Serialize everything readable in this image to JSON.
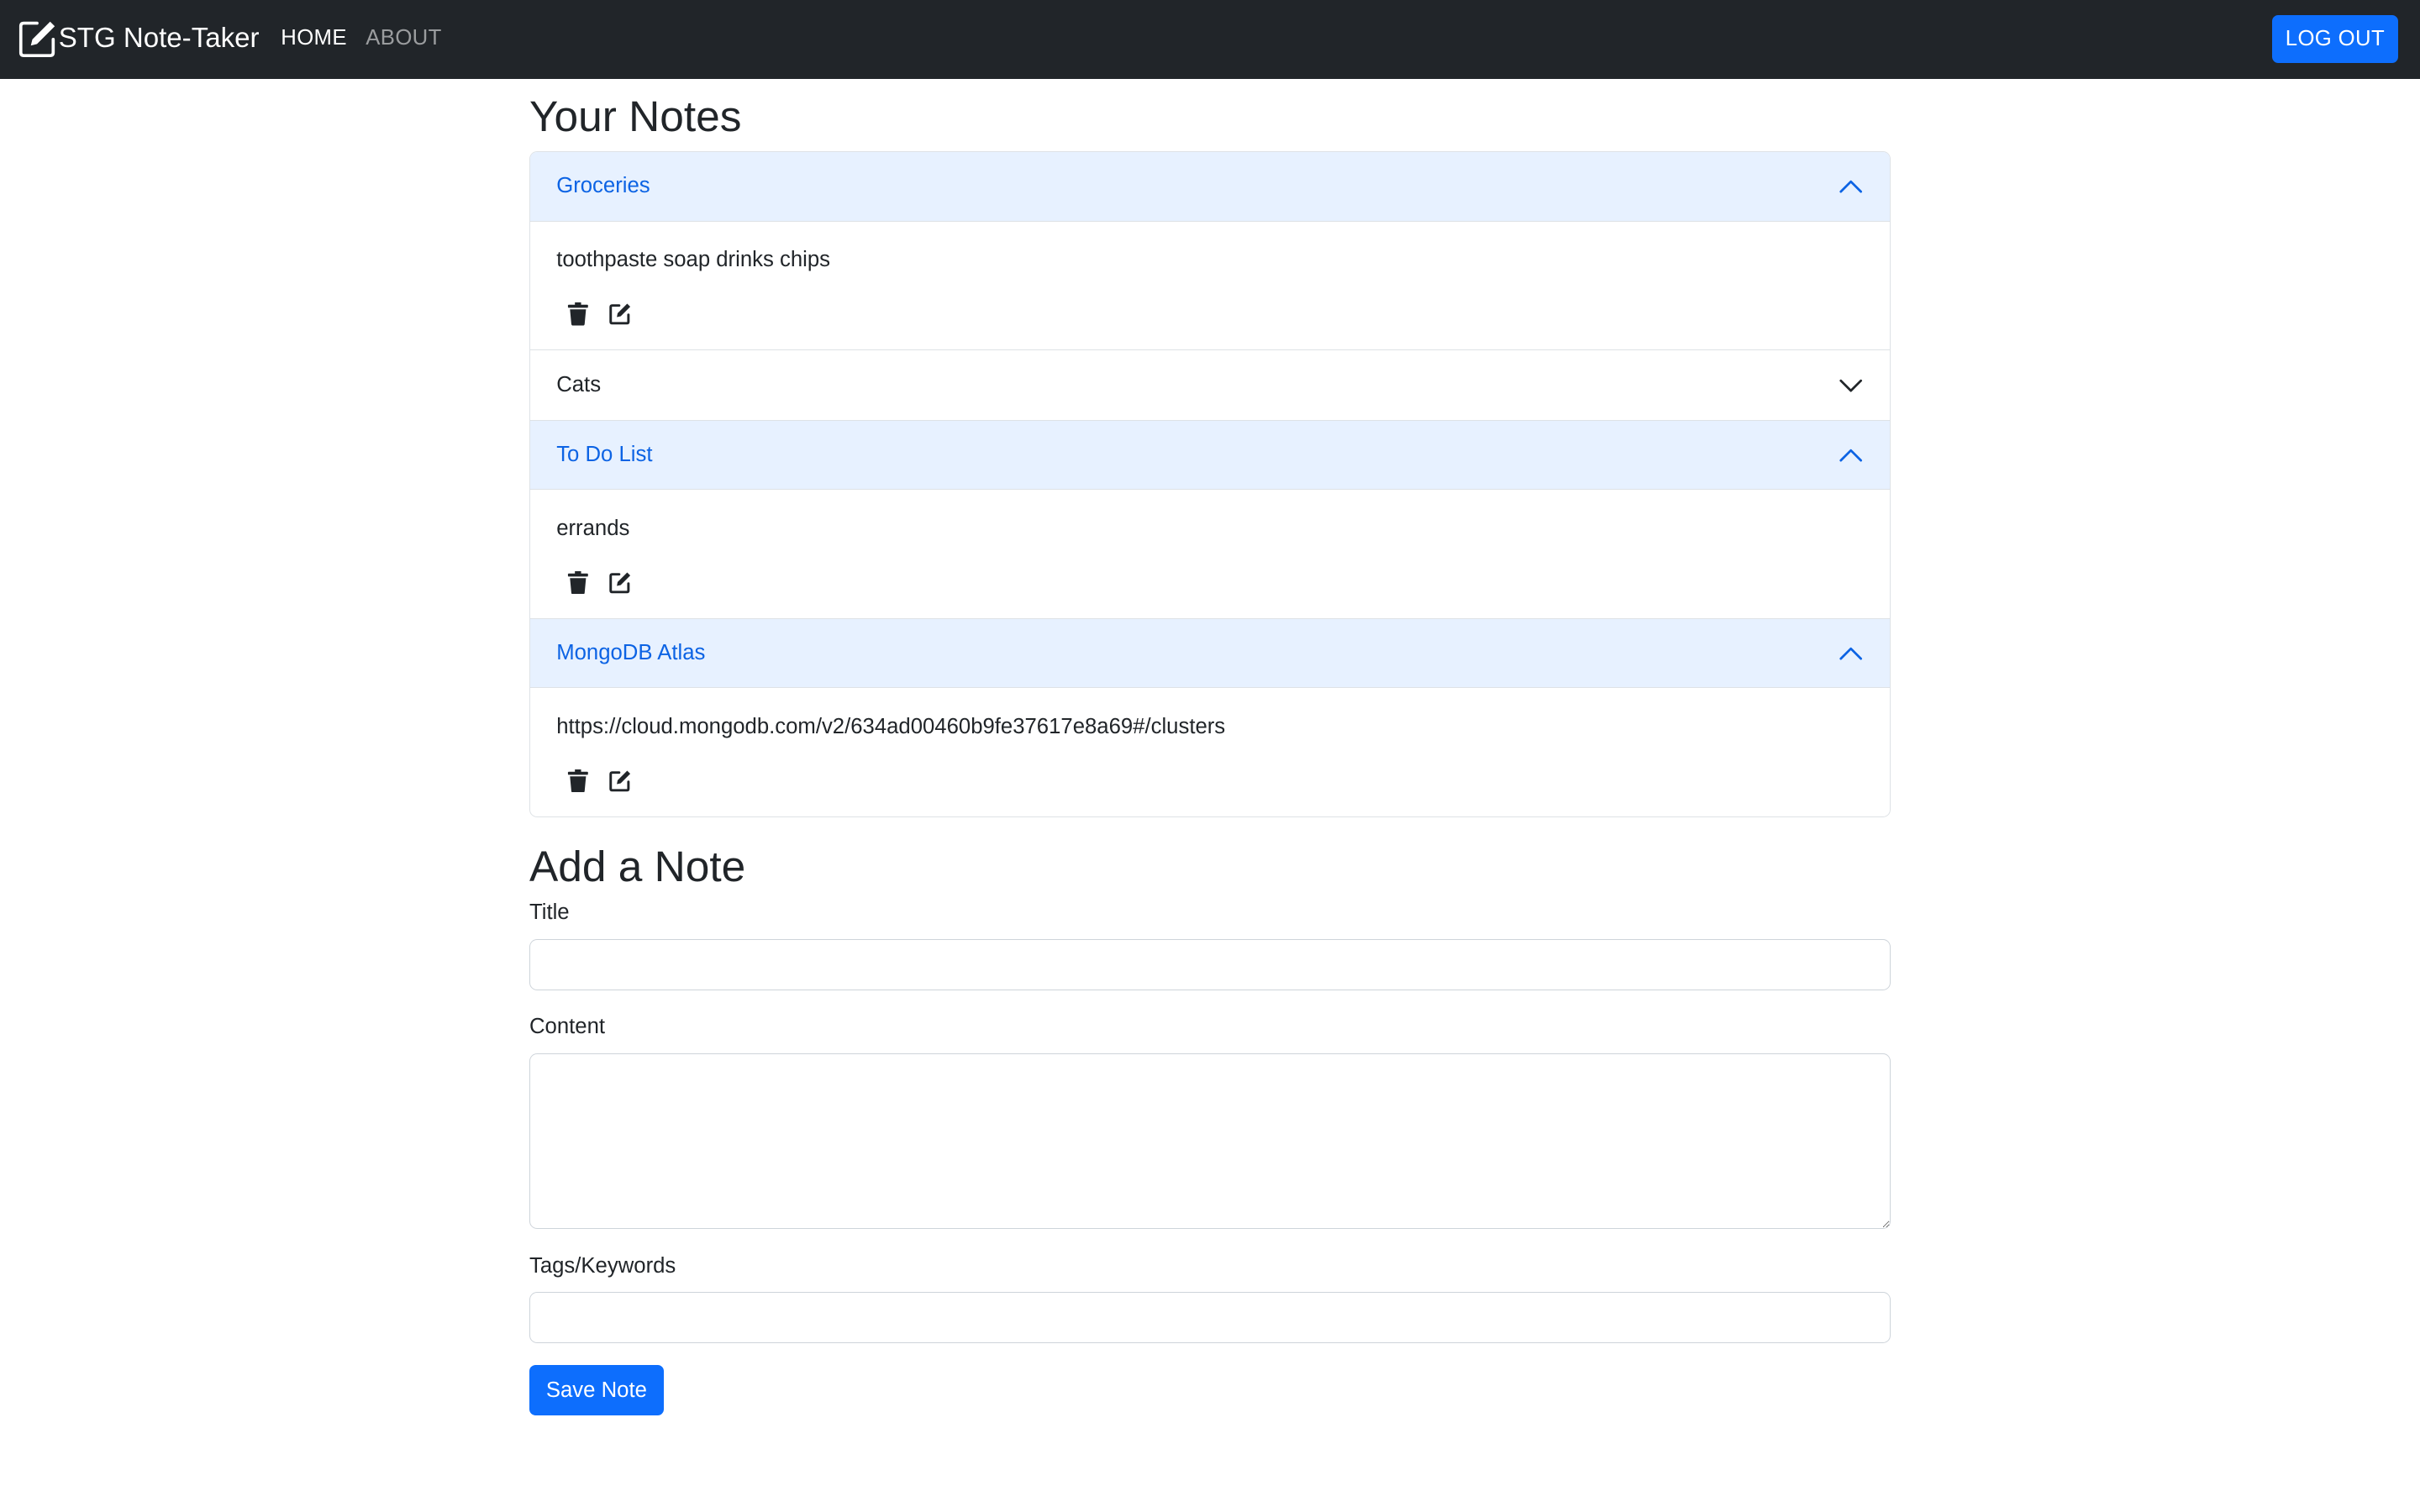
{
  "navbar": {
    "brand": "STG Note-Taker",
    "links": [
      {
        "label": "HOME"
      },
      {
        "label": "ABOUT"
      }
    ],
    "logout_label": "LOG OUT"
  },
  "notes_section": {
    "title": "Your Notes",
    "notes": [
      {
        "title": "Groceries",
        "content": "toothpaste soap drinks chips",
        "expanded": true
      },
      {
        "title": "Cats",
        "content": "",
        "expanded": false
      },
      {
        "title": "To Do List",
        "content": "errands",
        "expanded": true
      },
      {
        "title": "MongoDB Atlas",
        "content": "https://cloud.mongodb.com/v2/634ad00460b9fe37617e8a69#/clusters",
        "expanded": true
      }
    ]
  },
  "add_note": {
    "title": "Add a Note",
    "title_label": "Title",
    "title_value": "",
    "content_label": "Content",
    "content_value": "",
    "tags_label": "Tags/Keywords",
    "tags_value": "",
    "save_label": "Save Note"
  },
  "icons": {
    "brand": "pencil-square-icon",
    "expanded": "chevron-up-icon",
    "collapsed": "chevron-down-icon",
    "delete": "trash-icon",
    "edit": "edit-icon"
  },
  "colors": {
    "navbar_bg": "#212529",
    "primary": "#0d6efd",
    "accordion_active_bg": "#e7f1ff",
    "accordion_active_text": "#0c63e4"
  }
}
